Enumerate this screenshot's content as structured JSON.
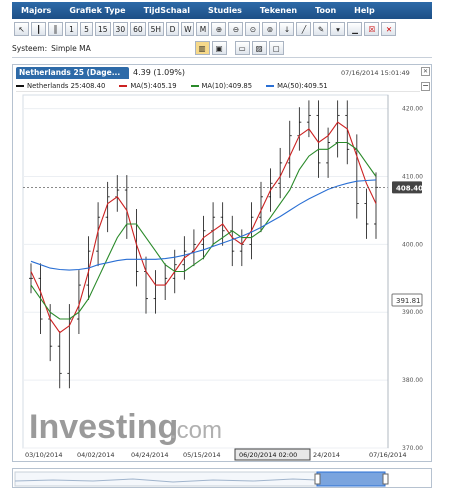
{
  "menu": [
    "Majors",
    "Grafiek Type",
    "TijdSchaal",
    "Studies",
    "Tekenen",
    "Toon",
    "Help"
  ],
  "toolbar": {
    "timeframes": [
      "1",
      "5",
      "15",
      "30",
      "60",
      "5H",
      "D",
      "W",
      "M"
    ]
  },
  "systeem": {
    "label": "Systeem:",
    "value": "Simple MA"
  },
  "tab": {
    "title": "Netherlands 25 (Dage...",
    "change": "4.39 (1.09%)",
    "datetime": "07/16/2014 15:01:49"
  },
  "legend": {
    "main": "Netherlands 25:408.40",
    "ma5": "MA(5):405.19",
    "ma10": "MA(10):409.85",
    "ma50": "MA(50):409.51"
  },
  "colors": {
    "ma5": "#cc2222",
    "ma10": "#2a8a2a",
    "ma50": "#2a6fd4",
    "candle": "#111111",
    "accent": "#2d6aa8"
  },
  "watermark": {
    "brand": "Investing",
    "suffix": ".com"
  },
  "price_tag": "408.40",
  "low_tag": "391.81",
  "crosshair_date": "06/20/2014 02:00",
  "chart_data": {
    "type": "line",
    "ylim": [
      370,
      422
    ],
    "yticks": [
      "420.00",
      "410.00",
      "400.00",
      "390.00",
      "380.00",
      "370.00"
    ],
    "ytick_values": [
      420,
      410,
      400,
      390,
      380,
      370
    ],
    "xticks": [
      "03/10/2014",
      "04/02/2014",
      "04/24/2014",
      "05/15/2014",
      "24/2014",
      "07/16/2014"
    ],
    "last_price": 408.4,
    "low_marker": 391.81,
    "series": [
      {
        "name": "MA(5):405.19",
        "key": "ma5",
        "values": [
          396,
          393,
          389,
          387,
          388,
          391,
          396,
          402,
          406,
          407,
          405,
          400,
          396,
          394,
          394,
          396,
          398,
          399,
          401,
          402,
          403,
          401,
          400,
          402,
          405,
          408,
          410,
          413,
          416,
          417,
          415,
          416,
          418,
          417,
          413,
          409,
          406
        ]
      },
      {
        "name": "MA(10):409.85",
        "key": "ma10",
        "values": [
          394,
          392,
          390,
          389,
          389,
          390,
          392,
          395,
          398,
          401,
          403,
          403,
          401,
          399,
          397,
          396,
          396,
          397,
          398,
          400,
          401,
          402,
          401,
          401,
          402,
          404,
          406,
          408,
          411,
          413,
          414,
          414,
          415,
          415,
          414,
          412,
          410
        ]
      },
      {
        "name": "MA(50):409.51",
        "key": "ma50",
        "values": [
          397.5,
          397,
          396.5,
          396.3,
          396.2,
          396.3,
          396.5,
          397,
          397.3,
          397.6,
          397.8,
          397.8,
          397.8,
          397.8,
          397.9,
          398.1,
          398.4,
          398.8,
          399.2,
          399.7,
          400.2,
          400.7,
          401.2,
          401.8,
          402.5,
          403.3,
          404.1,
          405.0,
          405.9,
          406.7,
          407.4,
          408.1,
          408.6,
          409.0,
          409.3,
          409.4,
          409.5
        ]
      },
      {
        "name": "Netherlands 25:408.40",
        "key": "candle",
        "values": [
          395,
          389,
          385,
          381,
          389,
          394,
          399,
          404,
          407,
          408,
          403,
          396,
          392,
          394,
          395,
          397,
          399,
          400,
          402,
          404,
          402,
          399,
          400,
          404,
          407,
          409,
          412,
          416,
          418,
          419,
          412,
          415,
          419,
          414,
          406,
          403,
          408.4
        ]
      }
    ]
  }
}
